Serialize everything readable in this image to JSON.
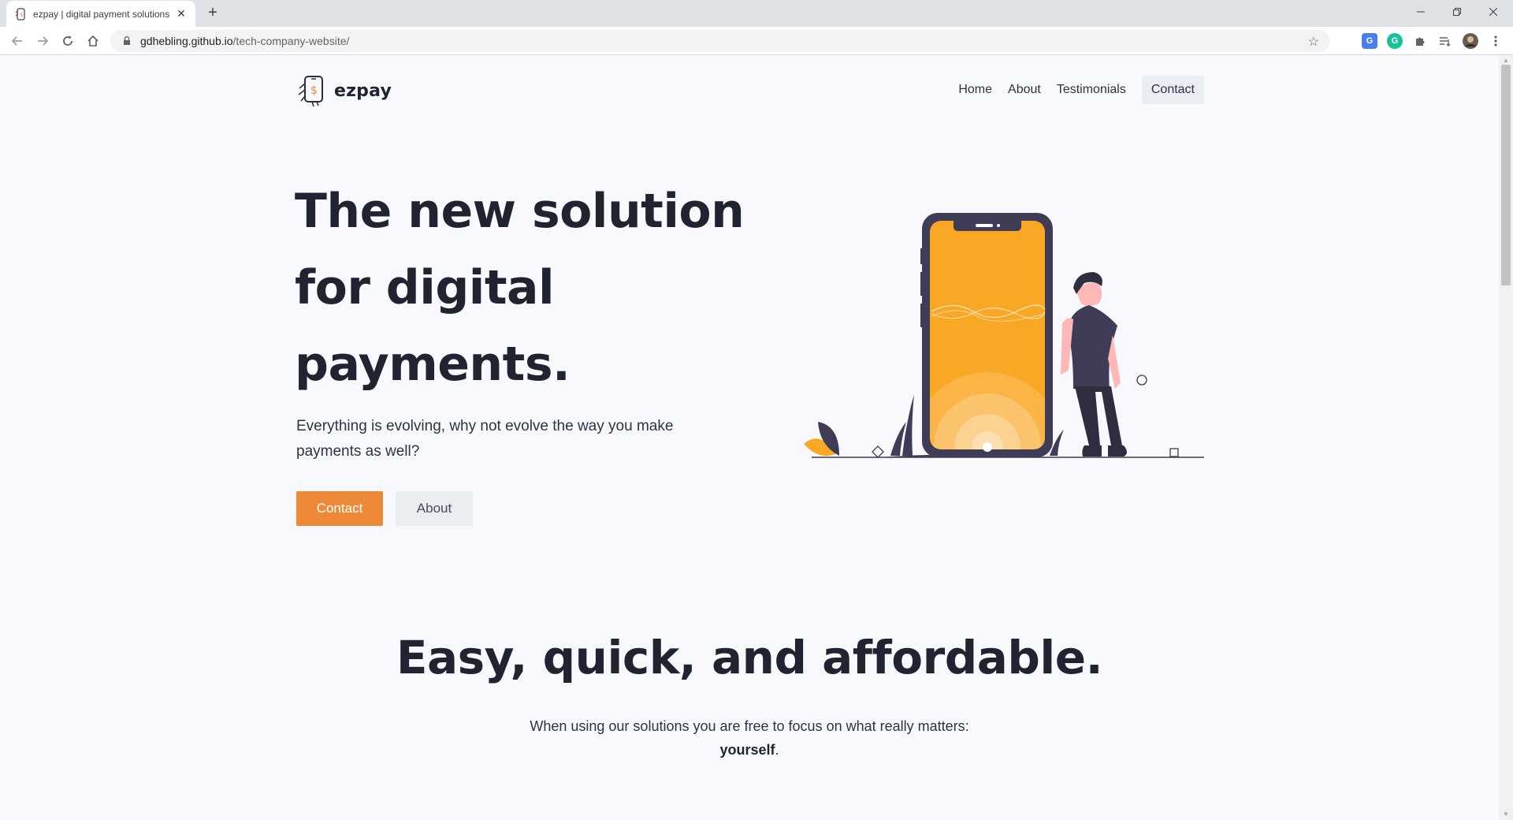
{
  "browser": {
    "tab_title": "ezpay | digital payment solutions",
    "url_host": "gdhebling.github.io",
    "url_path": "/tech-company-website/",
    "new_tab_label": "+",
    "tab_close_label": "✕"
  },
  "site": {
    "brand": "ezpay",
    "nav": {
      "home": "Home",
      "about": "About",
      "testimonials": "Testimonials",
      "contact": "Contact"
    },
    "hero": {
      "title_line1": "The new solution",
      "title_line2": "for digital",
      "title_line3": "payments.",
      "subtitle": "Everything is evolving, why not evolve the way you make payments as well?",
      "primary_button": "Contact",
      "secondary_button": "About"
    },
    "features": {
      "title": "Easy, quick, and affordable.",
      "text_before": "When using our solutions you are free to focus on what really matters:",
      "text_bold": "yourself",
      "text_after": "."
    }
  },
  "colors": {
    "accent": "#ee8a37",
    "phone_screen": "#f9a826",
    "dark": "#3f3d56",
    "background": "#f7f9fc"
  },
  "icons": [
    "back-icon",
    "forward-icon",
    "reload-icon",
    "home-icon",
    "lock-icon",
    "star-icon",
    "translate-icon",
    "grammarly-icon",
    "extensions-icon",
    "reading-list-icon",
    "profile-avatar",
    "menu-icon"
  ]
}
